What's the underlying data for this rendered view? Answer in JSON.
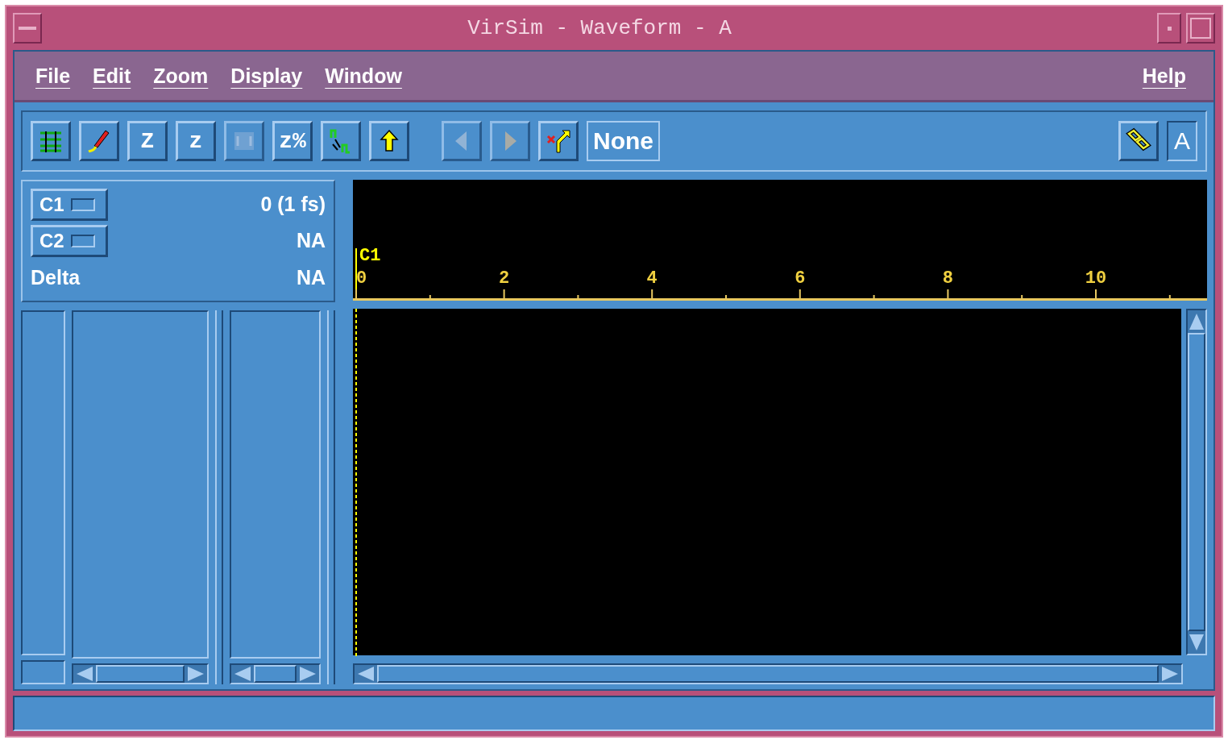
{
  "window": {
    "title": "VirSim - Waveform - A"
  },
  "menu": {
    "left": [
      "File",
      "Edit",
      "Zoom",
      "Display",
      "Window"
    ],
    "right": [
      "Help"
    ]
  },
  "toolbar": [
    {
      "kind": "icon",
      "disabled": false
    },
    {
      "kind": "icon",
      "disabled": false
    },
    {
      "kind": "text",
      "label": "Z",
      "disabled": false
    },
    {
      "kind": "text",
      "label": "z",
      "disabled": false
    },
    {
      "kind": "icon",
      "disabled": true
    },
    {
      "kind": "text",
      "label": "z%",
      "disabled": false
    },
    {
      "kind": "icon",
      "disabled": false
    },
    {
      "kind": "icon",
      "disabled": false
    },
    {
      "kind": "gap"
    },
    {
      "kind": "icon",
      "disabled": true
    },
    {
      "kind": "icon",
      "disabled": true
    },
    {
      "kind": "icon",
      "disabled": false
    }
  ],
  "group_field": {
    "value": "None"
  },
  "toolbar_right": [
    {
      "kind": "icon"
    },
    {
      "kind": "text",
      "label": "A"
    }
  ],
  "cursors": [
    {
      "kind": "button",
      "label": "C1",
      "value": "0 (1 fs)"
    },
    {
      "kind": "button",
      "label": "C2",
      "value": "NA"
    },
    {
      "kind": "text",
      "label": "Delta",
      "value": "NA"
    }
  ],
  "ruler": {
    "cursor_label": "C1",
    "ticks": [
      "0",
      "2",
      "4",
      "6",
      "8",
      "10"
    ]
  }
}
